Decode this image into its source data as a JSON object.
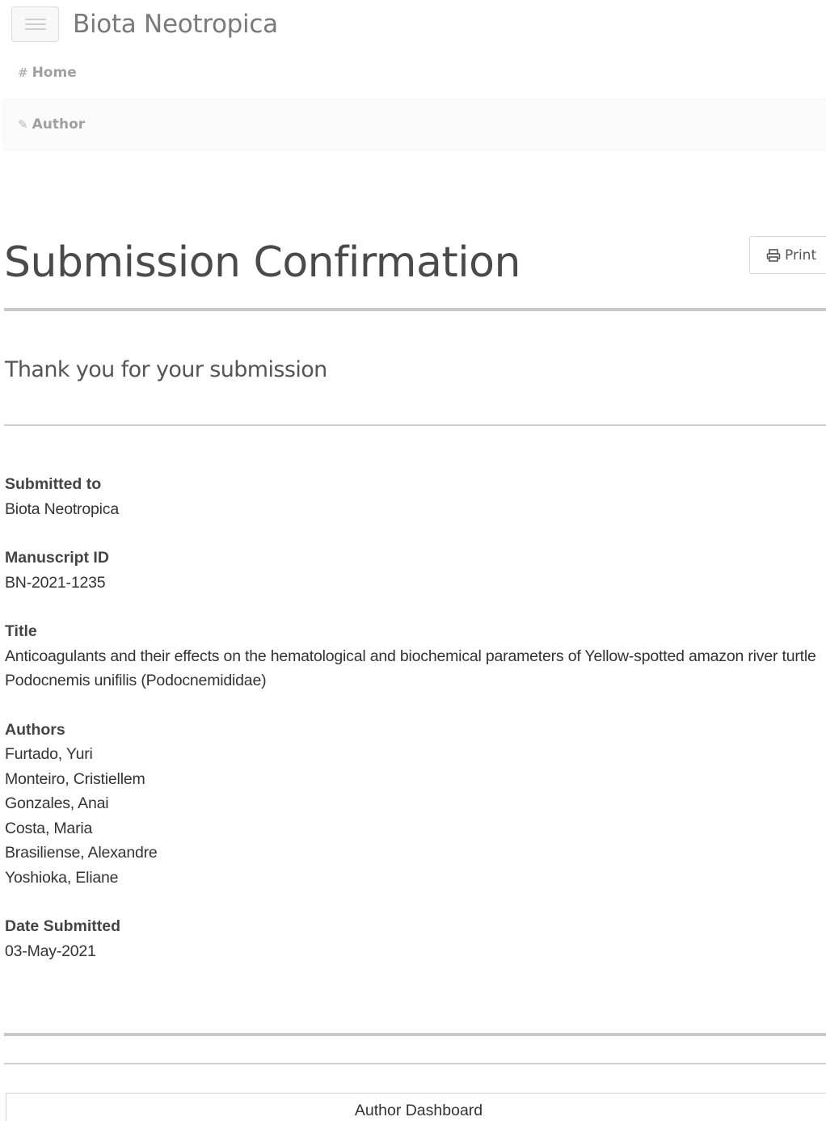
{
  "header": {
    "brand": "Biota Neotropica"
  },
  "nav": {
    "home_label": "Home",
    "author_label": "Author"
  },
  "page": {
    "title": "Submission Confirmation",
    "print_label": "Print",
    "thanks": "Thank you for your submission"
  },
  "submission": {
    "submitted_to_label": "Submitted to",
    "submitted_to": "Biota Neotropica",
    "manuscript_id_label": "Manuscript ID",
    "manuscript_id": "BN-2021-1235",
    "title_label": "Title",
    "title": "Anticoagulants and their effects on the hematological and biochemical parameters of Yellow-spotted amazon river turtle Podocnemis unifilis (Podocnemididae)",
    "authors_label": "Authors",
    "authors": [
      "Furtado, Yuri",
      "Monteiro, Cristiellem",
      "Gonzales, Anai",
      "Costa, Maria",
      "Brasiliense, Alexandre",
      "Yoshioka, Eliane"
    ],
    "date_submitted_label": "Date Submitted",
    "date_submitted": "03-May-2021"
  },
  "footer": {
    "dashboard_label": "Author Dashboard"
  },
  "icons": {
    "menu": "hamburger-icon",
    "home": "home-icon",
    "author": "pencil-icon",
    "print": "print-icon"
  }
}
